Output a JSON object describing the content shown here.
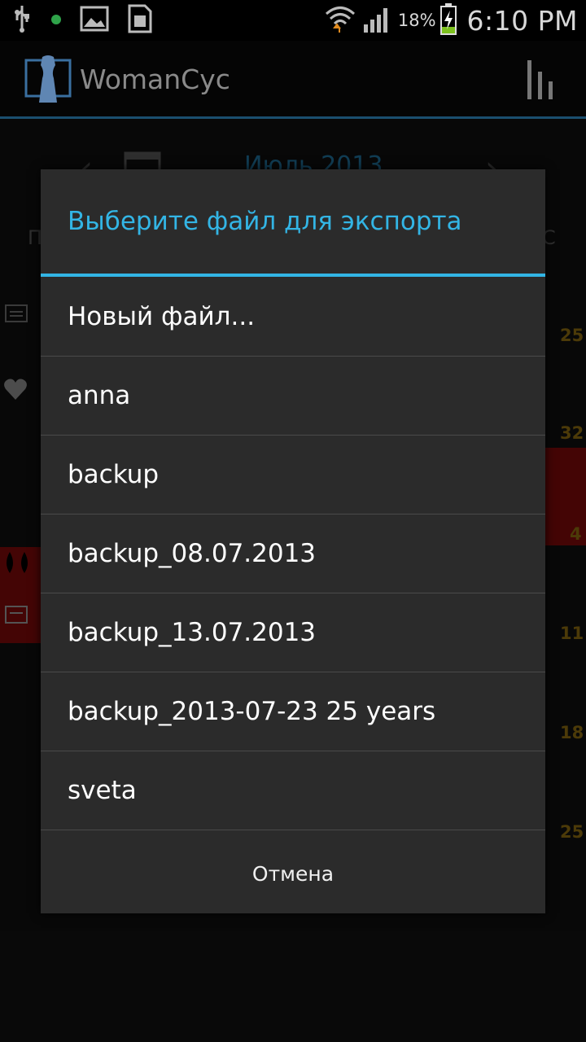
{
  "status_bar": {
    "battery_percent": "18%",
    "time": "6:10 PM",
    "icons": [
      "usb-icon",
      "notification-dot-icon",
      "picture-icon",
      "sim-card-icon",
      "wifi-icon",
      "signal-icon",
      "battery-charging-icon"
    ]
  },
  "action_bar": {
    "title": "WomanCyc",
    "icons": [
      "app-logo-icon",
      "statistics-icon"
    ]
  },
  "background": {
    "month_partial": "Июль 2013",
    "gold_numbers": [
      "25",
      "32",
      "4",
      "11",
      "18",
      "25"
    ]
  },
  "dialog": {
    "title": "Выберите файл для экспорта",
    "items": [
      {
        "label": "Новый файл..."
      },
      {
        "label": "anna"
      },
      {
        "label": "backup"
      },
      {
        "label": "backup_08.07.2013"
      },
      {
        "label": "backup_13.07.2013"
      },
      {
        "label": "backup_2013-07-23 25 years"
      },
      {
        "label": "sveta"
      }
    ],
    "cancel_label": "Отмена"
  },
  "colors": {
    "accent": "#33b5e5",
    "dialog_bg": "#2b2b2b",
    "calendar_red": "#7d0a0a",
    "gold": "#8a6a10"
  }
}
